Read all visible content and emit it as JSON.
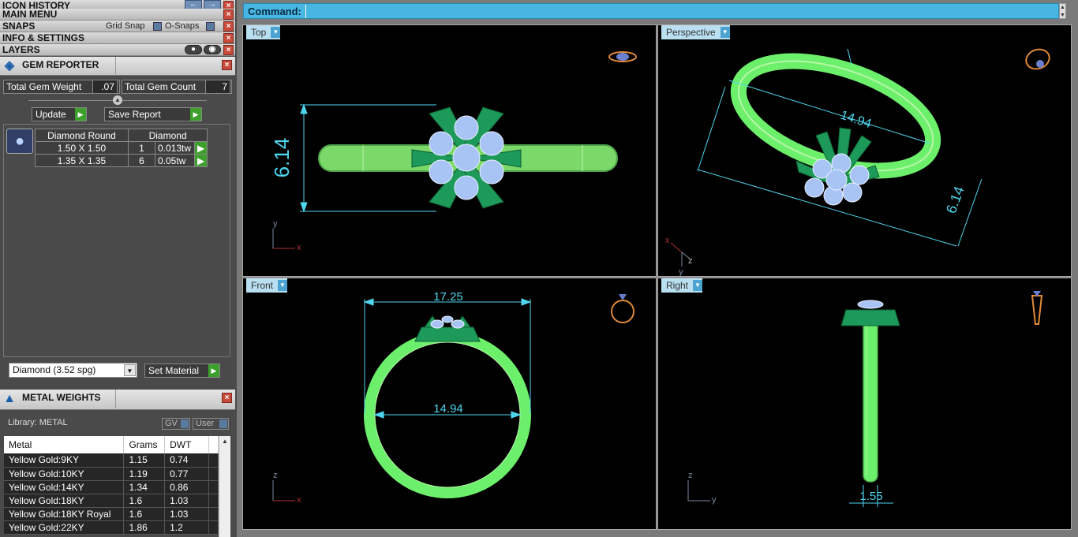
{
  "left_panel": {
    "icon_history": "ICON HISTORY",
    "main_menu": "MAIN MENU",
    "snaps": {
      "title": "SNAPS",
      "grid_snap": "Grid Snap",
      "o_snaps": "O-Snaps"
    },
    "info_settings": "INFO & SETTINGS",
    "layers": "LAYERS",
    "gem_reporter": {
      "title": "GEM REPORTER",
      "total_weight_label": "Total Gem Weight",
      "total_weight_value": ".07",
      "total_count_label": "Total Gem Count",
      "total_count_value": "7",
      "update_label": "Update",
      "save_report_label": "Save Report",
      "table_header": {
        "cut": "Diamond Round",
        "material": "Diamond"
      },
      "rows": [
        {
          "size": "1.50 X 1.50",
          "count": "1",
          "weight": "0.013tw"
        },
        {
          "size": "1.35 X 1.35",
          "count": "6",
          "weight": "0.05tw"
        }
      ],
      "material_select": "Diamond     (3.52 spg)",
      "set_material_label": "Set Material"
    },
    "metal_weights": {
      "title": "METAL WEIGHTS",
      "library_label": "Library: METAL",
      "gv_label": "GV",
      "user_label": "User",
      "columns": [
        "Metal",
        "Grams",
        "DWT"
      ],
      "rows": [
        [
          "Yellow Gold:9KY",
          "1.15",
          "0.74"
        ],
        [
          "Yellow Gold:10KY",
          "1.19",
          "0.77"
        ],
        [
          "Yellow Gold:14KY",
          "1.34",
          "0.86"
        ],
        [
          "Yellow Gold:18KY",
          "1.6",
          "1.03"
        ],
        [
          "Yellow Gold:18KY Royal",
          "1.6",
          "1.03"
        ],
        [
          "Yellow Gold:22KY",
          "1.86",
          "1.2"
        ]
      ]
    }
  },
  "command": {
    "label": "Command:"
  },
  "viewports": {
    "top": {
      "label": "Top",
      "dim_height": "6.14",
      "axis_x": "x",
      "axis_y": "y"
    },
    "perspective": {
      "label": "Perspective",
      "dim_inner": "14.94",
      "dim_height": "6.14",
      "axis_x": "x",
      "axis_y": "y",
      "axis_z": "z"
    },
    "front": {
      "label": "Front",
      "dim_outer": "17.25",
      "dim_inner": "14.94",
      "axis_x": "x",
      "axis_z": "z"
    },
    "right": {
      "label": "Right",
      "dim_width": "1.55",
      "axis_y": "y",
      "axis_z": "z"
    }
  },
  "colors": {
    "accent": "#47b6e3",
    "ring": "#6cf06c",
    "dimension": "#4fd6ef",
    "stone": "#a8c4f5",
    "prong": "#1d9a5a"
  }
}
